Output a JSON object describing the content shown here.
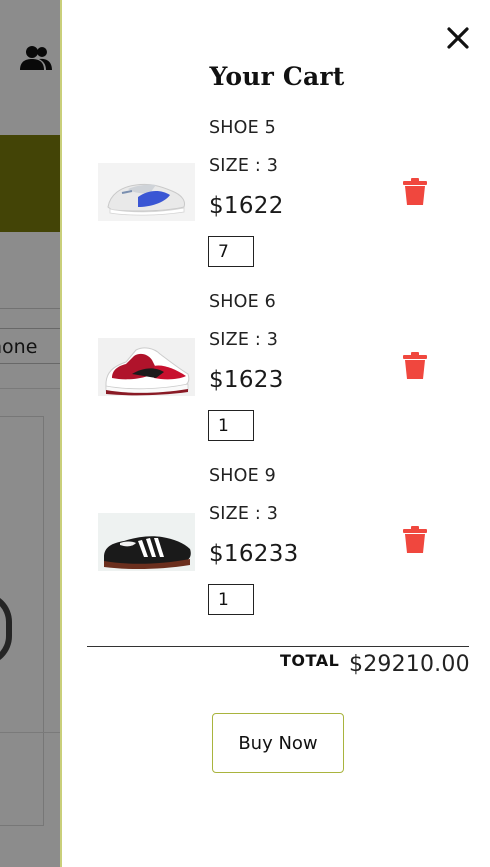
{
  "background": {
    "phone_field_text": "hone",
    "banner_color": "#7a7c0b"
  },
  "cart": {
    "title": "Your Cart",
    "close_icon": "close-icon",
    "delete_icon": "trash-icon",
    "delete_color": "#f0473e",
    "items": [
      {
        "name": "SHOE 5",
        "size": "SIZE : 3",
        "price": "$1622",
        "quantity": "7",
        "image": "white-blue-sneaker"
      },
      {
        "name": "SHOE 6",
        "size": "SIZE : 3",
        "price": "$1623",
        "quantity": "1",
        "image": "red-white-high-top-sneaker"
      },
      {
        "name": "SHOE 9",
        "size": "SIZE : 3",
        "price": "$16233",
        "quantity": "1",
        "image": "black-three-stripe-sneaker"
      }
    ],
    "total_label": "TOTAL",
    "total_value": "$29210.00",
    "buy_button": "Buy Now"
  },
  "side_widget": {
    "icon": "rocket-icon"
  }
}
